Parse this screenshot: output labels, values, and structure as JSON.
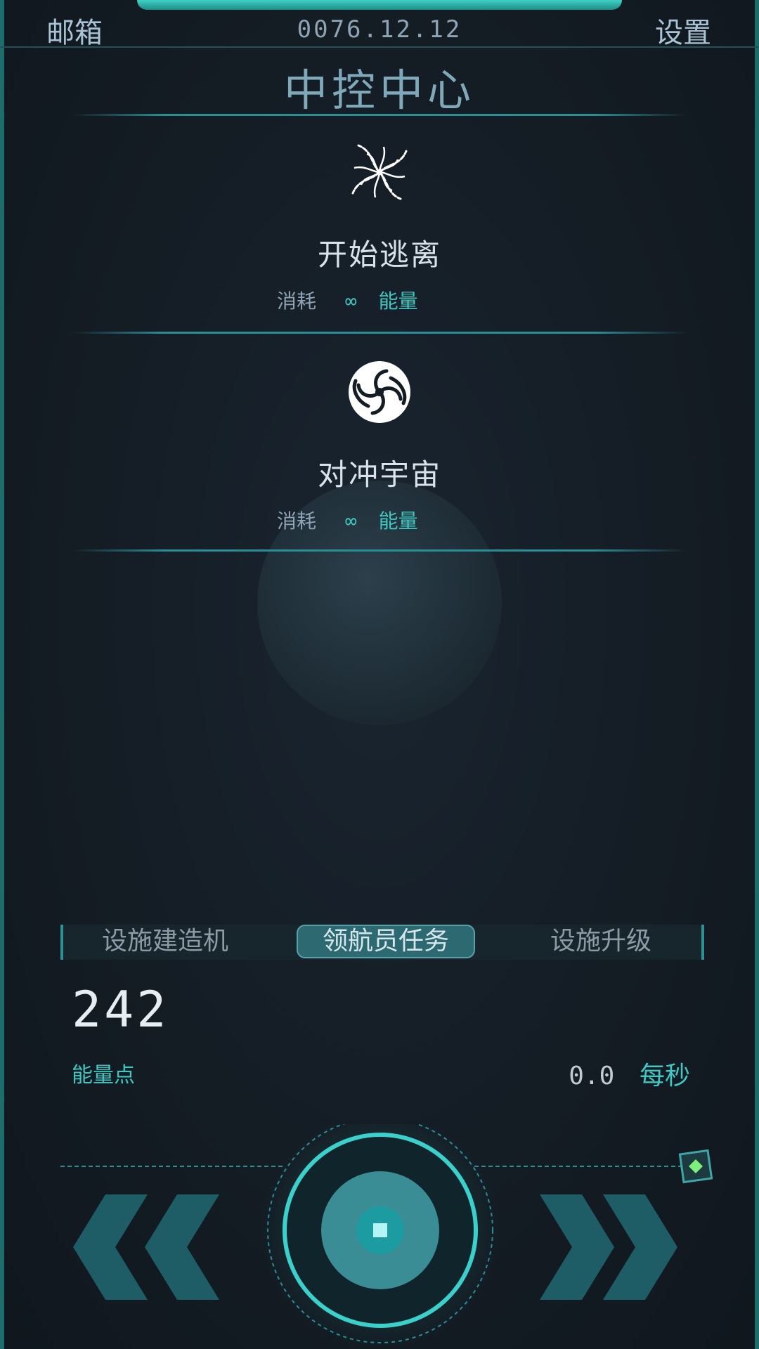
{
  "header": {
    "mail": "邮箱",
    "date": "0076.12.12",
    "settings": "设置",
    "title": "中控中心"
  },
  "actions": [
    {
      "icon": "spiral-galaxy-icon",
      "title": "开始逃离",
      "cost_label": "消耗",
      "cost_value": "∞",
      "cost_unit": "能量"
    },
    {
      "icon": "swirl-universe-icon",
      "title": "对冲宇宙",
      "cost_label": "消耗",
      "cost_value": "∞",
      "cost_unit": "能量"
    }
  ],
  "tabs": [
    {
      "label": "设施建造机",
      "active": false
    },
    {
      "label": "领航员任务",
      "active": true
    },
    {
      "label": "设施升级",
      "active": false
    }
  ],
  "energy": {
    "value": "242",
    "label": "能量点",
    "rate_value": "0.0",
    "rate_unit": "每秒"
  },
  "controls": {
    "prev": "double-chevron-left-icon",
    "center": "stop-button-icon",
    "next": "double-chevron-right-icon",
    "badge": "diamond-badge-icon"
  },
  "colors": {
    "accent": "#3fc7c2",
    "background": "#141c24",
    "divider": "#2a8e95"
  }
}
